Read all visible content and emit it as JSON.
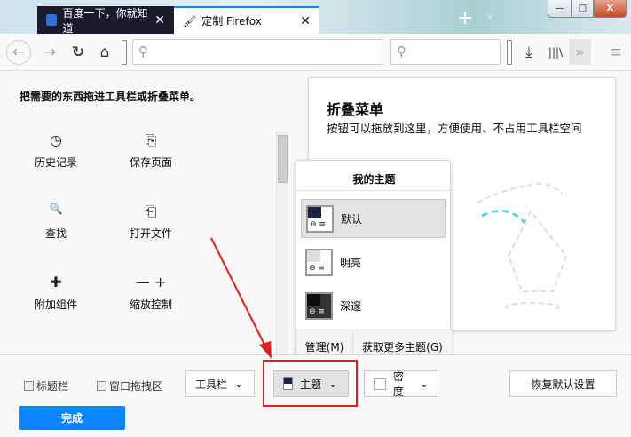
{
  "tabs": [
    {
      "label": "百度一下，你就知道",
      "close": "✕"
    },
    {
      "label": "定制 Firefox",
      "close": "✕"
    }
  ],
  "titlebar": {
    "new_tab": "+",
    "list_tabs": "∨",
    "minimize": "—",
    "maximize": "□",
    "close": "X"
  },
  "toolbar": {
    "back": "←",
    "forward": "→",
    "reload": "↻",
    "home": "⌂",
    "url_placeholder": "",
    "search_placeholder": "",
    "download": "⤓",
    "library": "|||\\",
    "overflow": "»",
    "menu": "≡"
  },
  "heading": "把需要的东西拖进工具栏或折叠菜单。",
  "palette": [
    {
      "label": "历史记录",
      "icon": "◷"
    },
    {
      "label": "保存页面",
      "icon": "⎘"
    },
    {
      "label": "查找",
      "icon": "🔍"
    },
    {
      "label": "打开文件",
      "icon": "⎗"
    },
    {
      "label": "附加组件",
      "icon": "✚"
    },
    {
      "label": "缩放控制",
      "icon": "—  +"
    }
  ],
  "overflow": {
    "title": "折叠菜单",
    "description": "按钮可以拖放到这里，方便使用、不占用工具栏空间"
  },
  "themes": {
    "title": "我的主题",
    "items": [
      {
        "label": "默认",
        "selected": true
      },
      {
        "label": "明亮",
        "selected": false
      },
      {
        "label": "深邃",
        "selected": false
      }
    ],
    "manage": "管理(M)",
    "get_more": "获取更多主题(G)"
  },
  "bottom": {
    "title_bar": "标题栏",
    "drag_space": "窗口拖拽区",
    "toolbars": "工具栏",
    "themes": "主题",
    "density": "密度",
    "restore": "恢复默认设置",
    "done": "完成"
  },
  "colors": {
    "accent": "#0a84ff",
    "annotation": "#e02020"
  }
}
